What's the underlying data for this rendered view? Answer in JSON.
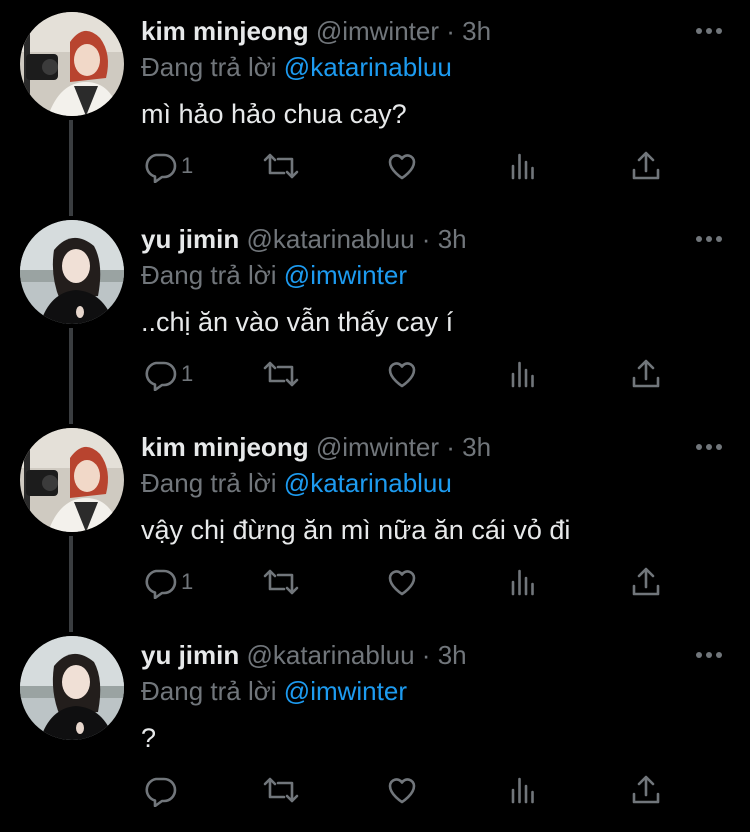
{
  "colors": {
    "background": "#000000",
    "text_primary": "#e7e9ea",
    "text_secondary": "#71767b",
    "accent": "#1d9bf0",
    "thread_line": "#3a3d40"
  },
  "labels": {
    "separator": "·",
    "replying_to": "Đang trả lời"
  },
  "icons": {
    "more": "more-horizontal-icon",
    "reply": "reply-bubble-icon",
    "retweet": "retweet-icon",
    "like": "heart-icon",
    "views": "analytics-icon",
    "share": "share-upload-icon"
  },
  "tweets": [
    {
      "name": "kim minjeong",
      "handle": "@imwinter",
      "time": "3h",
      "reply_to": "@katarinabluu",
      "text": "mì hảo hảo chua cay?",
      "reply_count": "1"
    },
    {
      "name": "yu jimin",
      "handle": "@katarinabluu",
      "time": "3h",
      "reply_to": "@imwinter",
      "text": "..chị ăn vào vẫn thấy cay í",
      "reply_count": "1"
    },
    {
      "name": "kim minjeong",
      "handle": "@imwinter",
      "time": "3h",
      "reply_to": "@katarinabluu",
      "text": "vậy chị đừng ăn mì nữa ăn cái vỏ đi",
      "reply_count": "1"
    },
    {
      "name": "yu jimin",
      "handle": "@katarinabluu",
      "time": "3h",
      "reply_to": "@imwinter",
      "text": "?",
      "reply_count": ""
    }
  ]
}
